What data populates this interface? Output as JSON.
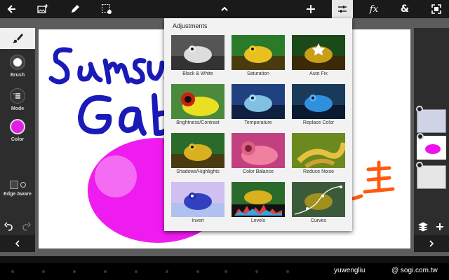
{
  "toolbar": {
    "icons": [
      "back-arrow-icon",
      "add-image-icon",
      "pencil-icon",
      "select-settings-icon",
      "chevron-up-icon",
      "plus-icon",
      "sliders-icon",
      "fx-icon",
      "ampersand-icon",
      "fullscreen-icon"
    ],
    "fx_label": "fx",
    "amp_label": "&"
  },
  "left_panel": {
    "tools": [
      {
        "label": "Brush"
      },
      {
        "label": "Mode"
      },
      {
        "label": "Color"
      },
      {
        "label": "Edge Aware"
      }
    ],
    "brush_color": "#e020e0"
  },
  "adjustments": {
    "title": "Adjustments",
    "items": [
      {
        "label": "Black & White"
      },
      {
        "label": "Saturation"
      },
      {
        "label": "Auto Fix"
      },
      {
        "label": "Brightness/Contrast"
      },
      {
        "label": "Temperature"
      },
      {
        "label": "Replace Color"
      },
      {
        "label": "Shadows/Highlights"
      },
      {
        "label": "Color Balance"
      },
      {
        "label": "Reduce Noise"
      },
      {
        "label": "Invert"
      },
      {
        "label": "Levels"
      },
      {
        "label": "Curves"
      }
    ]
  },
  "colors": {
    "ink": "#1a1ab8",
    "magenta": "#ee10ee",
    "orange": "#ff5a10",
    "accent_bar": "#1a1a1a"
  },
  "watermark": {
    "user": "yuwengliu",
    "site": "@ sogi.com.tw"
  }
}
